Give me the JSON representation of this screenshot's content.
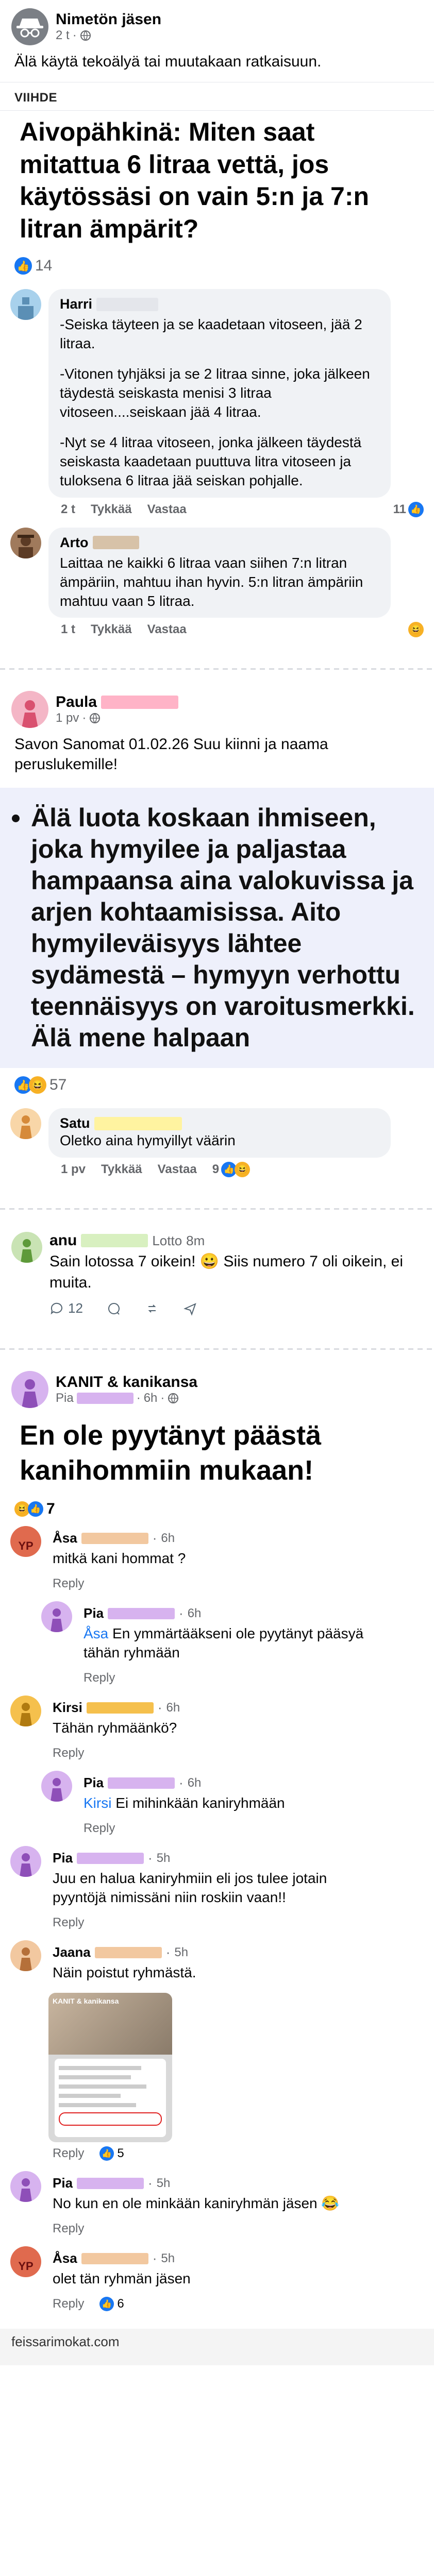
{
  "post1": {
    "author": "Nimetön jäsen",
    "meta_time": "2 t",
    "text": "Älä käytä tekoälyä tai muutakaan ratkaisuun.",
    "tag": "VIIHDE",
    "headline": "Aivopähkinä: Miten saat mitattua 6 litraa vettä, jos käytössäsi on vain 5:n ja 7:n litran ämpärit?",
    "reaction_count": "14",
    "comments": [
      {
        "name": "Harri",
        "lines": [
          "-Seiska täyteen ja se kaadetaan vitoseen, jää 2 litraa.",
          "-Vitonen tyhjäksi ja se 2 litraa sinne, joka jälkeen täydestä seiskasta menisi 3 litraa vitoseen....seiskaan jää 4 litraa.",
          "-Nyt se 4 litraa vitoseen, jonka jälkeen täydestä seiskasta kaadetaan puuttuva litra vitoseen ja tuloksena 6 litraa jää seiskan pohjalle."
        ],
        "time": "2 t",
        "like": "Tykkää",
        "reply": "Vastaa",
        "count": "11"
      },
      {
        "name": "Arto",
        "lines": [
          "Laittaa ne kaikki 6 litraa vaan siihen 7:n litran ämpäriin, mahtuu ihan hyvin. 5:n litran ämpäriin mahtuu vaan 5 litraa."
        ],
        "time": "1 t",
        "like": "Tykkää",
        "reply": "Vastaa"
      }
    ]
  },
  "post2": {
    "author": "Paula",
    "meta_time": "1 pv",
    "text": "Savon Sanomat 01.02.26 Suu kiinni ja naama peruslukemille!",
    "quote": "Älä luota koskaan ihmiseen, joka hymyilee ja paljastaa hampaansa aina valokuvissa ja arjen kohtaamisissa. Aito hymyileväisyys lähtee sydämestä – hymyyn verhottu teennäisyys on varoitusmerkki. Älä mene halpaan",
    "reaction_count": "57",
    "comment": {
      "name": "Satu",
      "text": "Oletko aina hymyillyt väärin",
      "time": "1 pv",
      "like": "Tykkää",
      "reply": "Vastaa",
      "count": "9"
    }
  },
  "post3": {
    "name": "anu",
    "handle": "Lotto",
    "time": "8m",
    "text": "Sain lotossa 7 oikein! 😀 Siis numero 7 oli oikein, ei muita.",
    "reply_count": "12"
  },
  "post4": {
    "group": "KANIT & kanikansa",
    "author": "Pia",
    "meta_time": "6h",
    "headline": "En ole pyytänyt päästä kanihommiin mukaan!",
    "reaction_count": "7",
    "reply_label": "Reply",
    "comments": [
      {
        "name": "Åsa",
        "time": "6h",
        "text": "mitkä kani hommat ?",
        "avatar": "yp",
        "indent": false
      },
      {
        "name": "Pia",
        "time": "6h",
        "mention": "Åsa",
        "text": " En ymmärtääkseni ole pyytänyt pääsyä tähän ryhmään",
        "avatar": "pia",
        "indent": true
      },
      {
        "name": "Kirsi",
        "time": "6h",
        "text": "Tähän ryhmäänkö?",
        "avatar": "kirsi",
        "indent": false
      },
      {
        "name": "Pia",
        "time": "6h",
        "mention": "Kirsi",
        "text": " Ei mihinkään kaniryhmään",
        "avatar": "pia",
        "indent": true
      },
      {
        "name": "Pia",
        "time": "5h",
        "text": "Juu en halua kaniryhmiin eli jos tulee jotain pyyntöjä nimissäni niin roskiin vaan!!",
        "avatar": "pia",
        "indent": false
      },
      {
        "name": "Jaana",
        "time": "5h",
        "text": "Näin poistut ryhmästä.",
        "avatar": "jaana",
        "indent": false,
        "attachment": true,
        "attachment_title": "KANIT & kanikansa",
        "likes": "5"
      },
      {
        "name": "Pia",
        "time": "5h",
        "text": "No kun en ole minkään kaniryhmän jäsen 😂",
        "avatar": "pia",
        "indent": false
      },
      {
        "name": "Åsa",
        "time": "5h",
        "text": "olet tän ryhmän jäsen",
        "avatar": "yp",
        "indent": false,
        "likes": "6"
      }
    ]
  },
  "footer": "feissarimokat.com",
  "colors": {
    "facebook_blue": "#1877f2",
    "gray_text": "#65676b",
    "bubble_bg": "#f0f2f5",
    "redaction_pink": "#ffb3c7",
    "redaction_orange": "#f2c8a0",
    "redaction_yellow": "#fff3a0",
    "redaction_green": "#d8f0c0",
    "redaction_purple": "#d7b3ef"
  }
}
